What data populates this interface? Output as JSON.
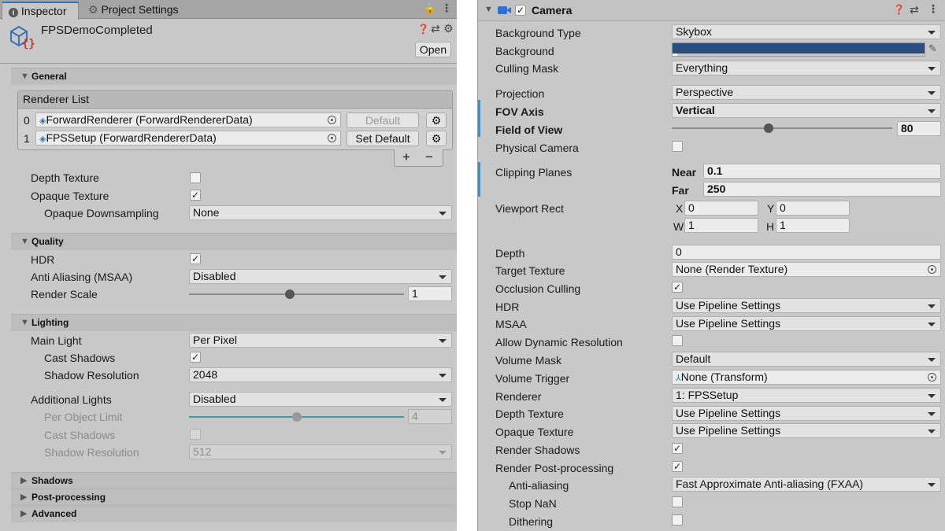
{
  "inspector": {
    "tabs": [
      {
        "label": "Inspector"
      },
      {
        "label": "Project Settings"
      }
    ],
    "asset_name": "FPSDemoCompleted",
    "open_button": "Open",
    "general": {
      "header": "General",
      "renderer_list_title": "Renderer List",
      "renderers": [
        {
          "index": "0",
          "name": "ForwardRenderer (ForwardRendererData)",
          "button": "Default"
        },
        {
          "index": "1",
          "name": "FPSSetup (ForwardRendererData)",
          "button": "Set Default"
        }
      ],
      "add": "+",
      "remove": "−",
      "depth_texture_label": "Depth Texture",
      "opaque_texture_label": "Opaque Texture",
      "opaque_downsampling_label": "Opaque Downsampling",
      "opaque_downsampling_value": "None"
    },
    "quality": {
      "header": "Quality",
      "hdr_label": "HDR",
      "aa_label": "Anti Aliasing (MSAA)",
      "aa_value": "Disabled",
      "render_scale_label": "Render Scale",
      "render_scale_value": "1",
      "render_scale_fraction": 0.47
    },
    "lighting": {
      "header": "Lighting",
      "main_light_label": "Main Light",
      "main_light_value": "Per Pixel",
      "cast_shadows_label": "Cast Shadows",
      "shadow_res_label": "Shadow Resolution",
      "shadow_res_value": "2048",
      "additional_lights_label": "Additional Lights",
      "additional_lights_value": "Disabled",
      "per_object_limit_label": "Per Object Limit",
      "per_object_limit_value": "4",
      "per_object_limit_fraction": 0.5,
      "add_cast_shadows_label": "Cast Shadows",
      "add_shadow_res_label": "Shadow Resolution",
      "add_shadow_res_value": "512"
    },
    "collapsed": [
      {
        "label": "Shadows"
      },
      {
        "label": "Post-processing"
      },
      {
        "label": "Advanced"
      }
    ]
  },
  "camera": {
    "title": "Camera",
    "accent_color": "#2b4d7e",
    "rows": {
      "background_type": {
        "label": "Background Type",
        "value": "Skybox"
      },
      "background": {
        "label": "Background"
      },
      "culling_mask": {
        "label": "Culling Mask",
        "value": "Everything"
      },
      "projection": {
        "label": "Projection",
        "value": "Perspective"
      },
      "fov_axis": {
        "label": "FOV Axis",
        "value": "Vertical"
      },
      "fov": {
        "label": "Field of View",
        "value": "80",
        "fraction": 0.44
      },
      "physical_camera": {
        "label": "Physical Camera"
      },
      "clipping": {
        "label": "Clipping Planes",
        "near_label": "Near",
        "near": "0.1",
        "far_label": "Far",
        "far": "250"
      },
      "viewport": {
        "label": "Viewport Rect",
        "x_label": "X",
        "x": "0",
        "y_label": "Y",
        "y": "0",
        "w_label": "W",
        "w": "1",
        "h_label": "H",
        "h": "1"
      },
      "depth": {
        "label": "Depth",
        "value": "0"
      },
      "target_texture": {
        "label": "Target Texture",
        "value": "None (Render Texture)"
      },
      "occlusion": {
        "label": "Occlusion Culling"
      },
      "hdr": {
        "label": "HDR",
        "value": "Use Pipeline Settings"
      },
      "msaa": {
        "label": "MSAA",
        "value": "Use Pipeline Settings"
      },
      "dyn_res": {
        "label": "Allow Dynamic Resolution"
      },
      "volume_mask": {
        "label": "Volume Mask",
        "value": "Default"
      },
      "volume_trigger": {
        "label": "Volume Trigger",
        "value": "None (Transform)"
      },
      "renderer": {
        "label": "Renderer",
        "value": "1: FPSSetup"
      },
      "depth_texture": {
        "label": "Depth Texture",
        "value": "Use Pipeline Settings"
      },
      "opaque_texture": {
        "label": "Opaque Texture",
        "value": "Use Pipeline Settings"
      },
      "render_shadows": {
        "label": "Render Shadows"
      },
      "post_processing": {
        "label": "Render Post-processing"
      },
      "anti_aliasing": {
        "label": "Anti-aliasing",
        "value": "Fast Approximate Anti-aliasing (FXAA)"
      },
      "stop_nan": {
        "label": "Stop NaN"
      },
      "dithering": {
        "label": "Dithering"
      }
    }
  }
}
